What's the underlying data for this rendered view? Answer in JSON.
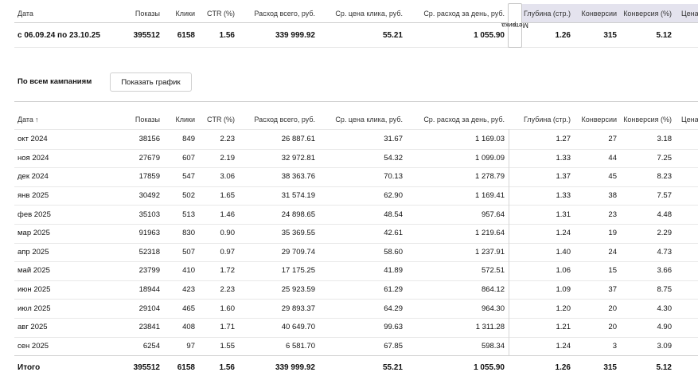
{
  "columns": {
    "date": "Дата",
    "date_sorted": "Дата",
    "sort_arrow": "↑",
    "impressions": "Показы",
    "clicks": "Клики",
    "ctr": "CTR (%)",
    "spend_total": "Расход всего, руб.",
    "avg_cpc": "Ср. цена клика, руб.",
    "avg_daily_spend": "Ср. расход за день, руб.",
    "depth": "Глубина (стр.)",
    "conversions": "Конверсии",
    "conversion_rate": "Конверсия (%)",
    "price": "Цена"
  },
  "metrika_tab": {
    "label": "Метрика",
    "icon": "collapse-arrows-icon",
    "glyph": "»"
  },
  "summary": {
    "date": "с 06.09.24 по 23.10.25",
    "impressions": "395512",
    "clicks": "6158",
    "ctr": "1.56",
    "spend_total": "339 999.92",
    "avg_cpc": "55.21",
    "avg_daily_spend": "1 055.90",
    "depth": "1.26",
    "conversions": "315",
    "conversion_rate": "5.12"
  },
  "section": {
    "title": "По всем кампаниям",
    "show_graph_button": "Показать график"
  },
  "rows": [
    {
      "date": "окт 2024",
      "impressions": "38156",
      "clicks": "849",
      "ctr": "2.23",
      "spend_total": "26 887.61",
      "avg_cpc": "31.67",
      "avg_daily_spend": "1 169.03",
      "depth": "1.27",
      "conversions": "27",
      "conversion_rate": "3.18"
    },
    {
      "date": "ноя 2024",
      "impressions": "27679",
      "clicks": "607",
      "ctr": "2.19",
      "spend_total": "32 972.81",
      "avg_cpc": "54.32",
      "avg_daily_spend": "1 099.09",
      "depth": "1.33",
      "conversions": "44",
      "conversion_rate": "7.25"
    },
    {
      "date": "дек 2024",
      "impressions": "17859",
      "clicks": "547",
      "ctr": "3.06",
      "spend_total": "38 363.76",
      "avg_cpc": "70.13",
      "avg_daily_spend": "1 278.79",
      "depth": "1.37",
      "conversions": "45",
      "conversion_rate": "8.23"
    },
    {
      "date": "янв 2025",
      "impressions": "30492",
      "clicks": "502",
      "ctr": "1.65",
      "spend_total": "31 574.19",
      "avg_cpc": "62.90",
      "avg_daily_spend": "1 169.41",
      "depth": "1.33",
      "conversions": "38",
      "conversion_rate": "7.57"
    },
    {
      "date": "фев 2025",
      "impressions": "35103",
      "clicks": "513",
      "ctr": "1.46",
      "spend_total": "24 898.65",
      "avg_cpc": "48.54",
      "avg_daily_spend": "957.64",
      "depth": "1.31",
      "conversions": "23",
      "conversion_rate": "4.48"
    },
    {
      "date": "мар 2025",
      "impressions": "91963",
      "clicks": "830",
      "ctr": "0.90",
      "spend_total": "35 369.55",
      "avg_cpc": "42.61",
      "avg_daily_spend": "1 219.64",
      "depth": "1.24",
      "conversions": "19",
      "conversion_rate": "2.29"
    },
    {
      "date": "апр 2025",
      "impressions": "52318",
      "clicks": "507",
      "ctr": "0.97",
      "spend_total": "29 709.74",
      "avg_cpc": "58.60",
      "avg_daily_spend": "1 237.91",
      "depth": "1.40",
      "conversions": "24",
      "conversion_rate": "4.73"
    },
    {
      "date": "май 2025",
      "impressions": "23799",
      "clicks": "410",
      "ctr": "1.72",
      "spend_total": "17 175.25",
      "avg_cpc": "41.89",
      "avg_daily_spend": "572.51",
      "depth": "1.06",
      "conversions": "15",
      "conversion_rate": "3.66"
    },
    {
      "date": "июн 2025",
      "impressions": "18944",
      "clicks": "423",
      "ctr": "2.23",
      "spend_total": "25 923.59",
      "avg_cpc": "61.29",
      "avg_daily_spend": "864.12",
      "depth": "1.09",
      "conversions": "37",
      "conversion_rate": "8.75"
    },
    {
      "date": "июл 2025",
      "impressions": "29104",
      "clicks": "465",
      "ctr": "1.60",
      "spend_total": "29 893.37",
      "avg_cpc": "64.29",
      "avg_daily_spend": "964.30",
      "depth": "1.20",
      "conversions": "20",
      "conversion_rate": "4.30"
    },
    {
      "date": "авг 2025",
      "impressions": "23841",
      "clicks": "408",
      "ctr": "1.71",
      "spend_total": "40 649.70",
      "avg_cpc": "99.63",
      "avg_daily_spend": "1 311.28",
      "depth": "1.21",
      "conversions": "20",
      "conversion_rate": "4.90"
    },
    {
      "date": "сен 2025",
      "impressions": "6254",
      "clicks": "97",
      "ctr": "1.55",
      "spend_total": "6 581.70",
      "avg_cpc": "67.85",
      "avg_daily_spend": "598.34",
      "depth": "1.24",
      "conversions": "3",
      "conversion_rate": "3.09"
    }
  ],
  "total": {
    "label": "Итого",
    "impressions": "395512",
    "clicks": "6158",
    "ctr": "1.56",
    "spend_total": "339 999.92",
    "avg_cpc": "55.21",
    "avg_daily_spend": "1 055.90",
    "depth": "1.26",
    "conversions": "315",
    "conversion_rate": "5.12"
  }
}
